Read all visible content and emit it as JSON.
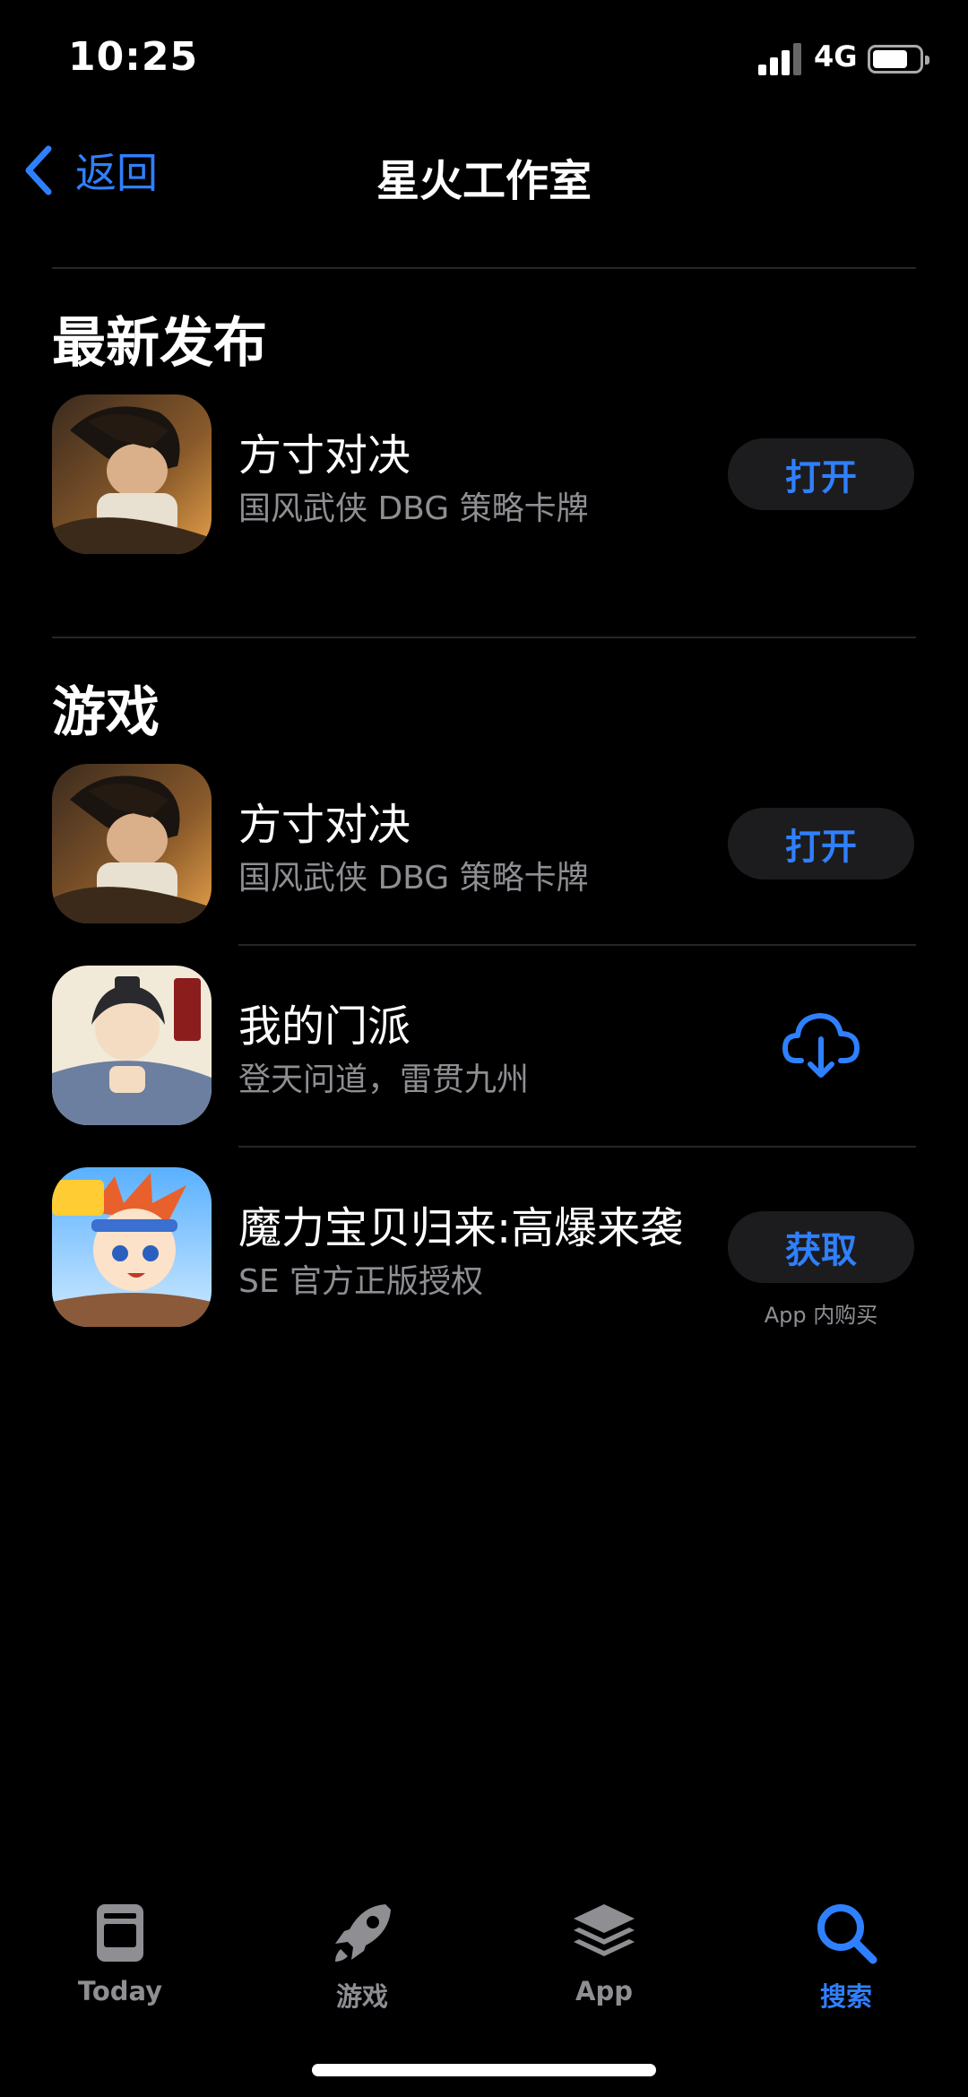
{
  "status_bar": {
    "time": "10:25",
    "network": "4G"
  },
  "nav": {
    "back_label": "返回",
    "title": "星火工作室"
  },
  "sections": {
    "latest": {
      "title": "最新发布",
      "items": [
        {
          "name": "方寸对决",
          "subtitle": "国风武侠 DBG 策略卡牌",
          "action": "打开"
        }
      ]
    },
    "games": {
      "title": "游戏",
      "items": [
        {
          "name": "方寸对决",
          "subtitle": "国风武侠 DBG 策略卡牌",
          "action": "打开"
        },
        {
          "name": "我的门派",
          "subtitle": "登天问道，雷贯九州",
          "action_icon": "cloud-download-icon"
        },
        {
          "name": "魔力宝贝归来:高爆来袭",
          "subtitle": "SE 官方正版授权",
          "action": "获取",
          "note": "App 内购买"
        }
      ]
    }
  },
  "tabbar": {
    "tabs": [
      {
        "label": "Today",
        "icon": "today-icon"
      },
      {
        "label": "游戏",
        "icon": "rocket-icon"
      },
      {
        "label": "App",
        "icon": "stack-icon"
      },
      {
        "label": "搜索",
        "icon": "search-icon",
        "active": true
      }
    ]
  },
  "colors": {
    "accent": "#2f80ff",
    "background": "#000000",
    "pill": "#1c1c1e",
    "secondary_text": "#8e8e93"
  },
  "icon_art": {
    "game1": "warrior-portrait",
    "game2": "chibi-sect-master",
    "game3": "anime-boy-adventurer"
  }
}
